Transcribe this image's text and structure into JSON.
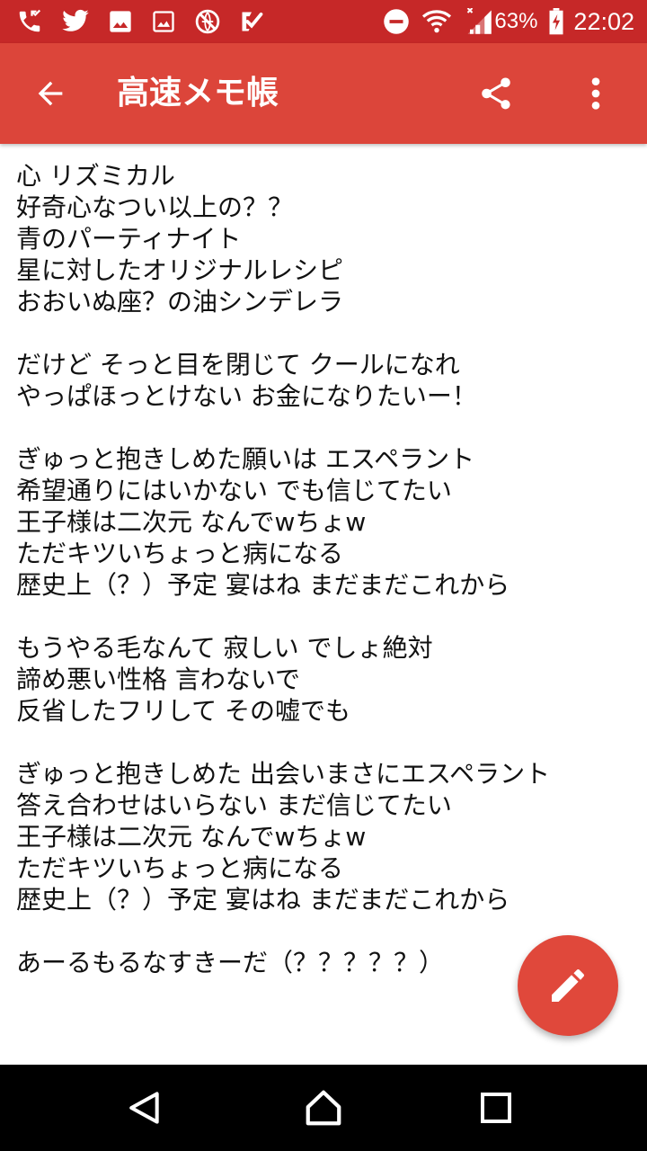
{
  "status_bar": {
    "battery_percent": "63%",
    "time": "22:02",
    "left_icons": [
      "missed-call-icon",
      "twitter-icon",
      "image-icon",
      "image-outline-icon",
      "no-network-icon",
      "check-badge-icon"
    ],
    "right_icons": [
      "do-not-disturb-icon",
      "wifi-icon",
      "signal-icon",
      "battery-charging-icon"
    ]
  },
  "app_bar": {
    "title": "高速メモ帳",
    "icons": [
      "arrow-back-icon",
      "share-icon",
      "more-vert-icon"
    ]
  },
  "memo": {
    "lines": [
      "心 リズミカル",
      "好奇心なつい以上の？？",
      "青のパーティナイト",
      "星に対したオリジナルレシピ",
      "おおいぬ座？の油シンデレラ",
      "",
      "だけど そっと目を閉じて クールになれ",
      "やっぱほっとけない お金になりたいー！",
      "",
      "ぎゅっと抱きしめた願いは エスペラント",
      "希望通りにはいかない でも信じてたい",
      "王子様は二次元 なんでwちょw",
      "ただキツいちょっと病になる",
      "歴史上（？）予定 宴はね まだまだこれから",
      "",
      "もうやる毛なんて 寂しい でしょ絶対",
      "諦め悪い性格 言わないで",
      "反省したフリして その嘘でも",
      "",
      "ぎゅっと抱きしめた 出会いまさにエスペラント",
      "答え合わせはいらない まだ信じてたい",
      "王子様は二次元 なんでwちょw",
      "ただキツいちょっと病になる",
      "歴史上（？）予定 宴はね まだまだこれから",
      "",
      "あーるもるなすきーだ（？？？？？）"
    ]
  },
  "fab": {
    "icon": "pencil-edit-icon"
  },
  "nav_bar": {
    "icons": [
      "nav-back-icon",
      "nav-home-icon",
      "nav-recents-icon"
    ]
  },
  "colors": {
    "status_bar": "#c62828",
    "app_bar": "#dc453a",
    "fab": "#e0483b",
    "text": "#111111",
    "nav_bar": "#000000"
  }
}
